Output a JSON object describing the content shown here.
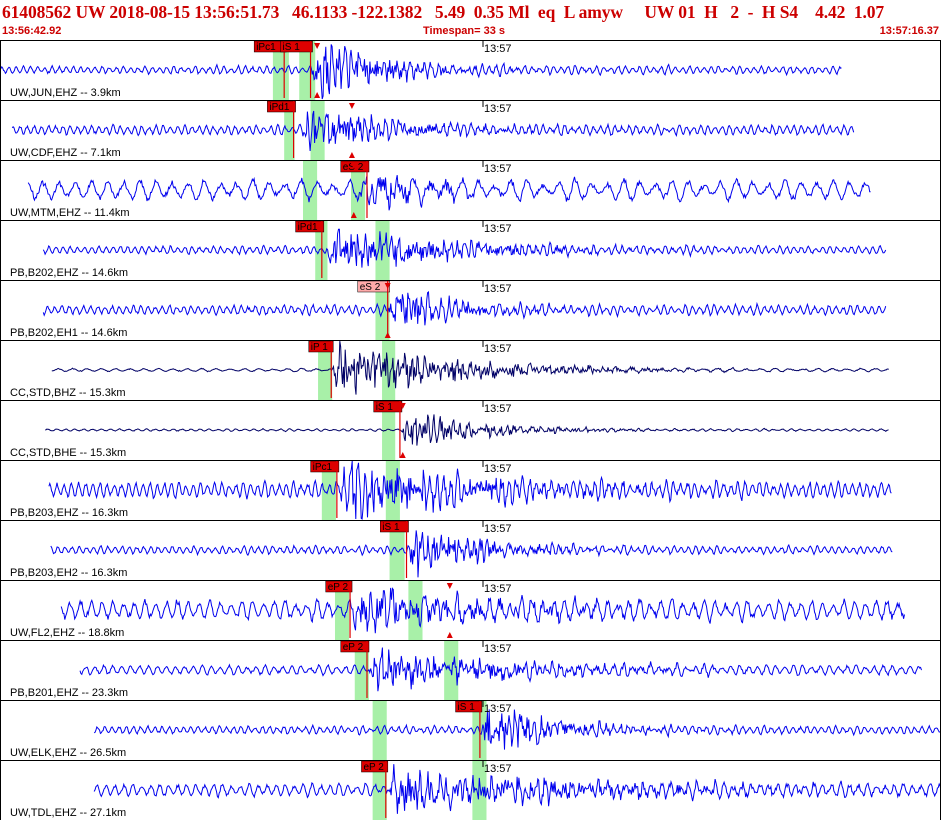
{
  "header": {
    "title": "61408562 UW 2018-08-15 13:56:51.73   46.1133 -122.1382   5.49  0.35 Ml  eq  L amyw     UW 01  H   2  -  H S4    4.42  1.07",
    "start_time": "13:56:42.92",
    "timespan": "Timespan=  33 s",
    "end_time": "13:57:16.37"
  },
  "colors": {
    "trace": "#0000ee",
    "trace_alt": "#000066",
    "pick_box": "#dd0000",
    "pick_box_light": "#ffaaaa",
    "window": "#a8f0a8",
    "frame": "#000000"
  },
  "chart_data": {
    "type": "line",
    "x_unit": "time (UTC)",
    "x_range": [
      "13:56:42.92",
      "13:57:16.37"
    ],
    "minute_mark": "13:57",
    "panels": [
      {
        "label": "UW,JUN,EHZ -- 3.9km",
        "start": 0.0,
        "end": 0.895,
        "onset": 0.33,
        "amp": 0.45,
        "noise": 0.05,
        "decay": 0.07,
        "period": 0.004,
        "color": "trace",
        "picks": [
          {
            "label": "iPc1",
            "t": 0.302,
            "box_w": 0.034,
            "light": false
          },
          {
            "label": "iS 1",
            "t": 0.33,
            "box_w": 0.034,
            "light": false
          }
        ],
        "windows": [
          {
            "start": 0.29,
            "end": 0.307
          },
          {
            "start": 0.318,
            "end": 0.335
          }
        ],
        "markers": [
          0.337
        ]
      },
      {
        "label": "UW,CDF,EHZ -- 7.1km",
        "start": 0.013,
        "end": 0.908,
        "onset": 0.317,
        "amp": 0.3,
        "noise": 0.06,
        "decay": 0.1,
        "period": 0.004,
        "color": "trace",
        "picks": [
          {
            "label": "iPd1",
            "t": 0.312,
            "box_w": 0.03,
            "light": false
          }
        ],
        "windows": [
          {
            "start": 0.302,
            "end": 0.313
          },
          {
            "start": 0.33,
            "end": 0.345
          }
        ],
        "markers": [
          0.374
        ]
      },
      {
        "label": "UW,MTM,EHZ -- 11.4km",
        "start": 0.03,
        "end": 0.926,
        "onset": 0.38,
        "amp": 0.28,
        "noise": 0.12,
        "decay": 0.06,
        "period": 0.009,
        "color": "trace",
        "picks": [
          {
            "label": "eS 2",
            "t": 0.39,
            "box_w": 0.03,
            "light": false
          }
        ],
        "windows": [
          {
            "start": 0.322,
            "end": 0.337
          },
          {
            "start": 0.373,
            "end": 0.388
          }
        ],
        "markers": [
          0.376
        ]
      },
      {
        "label": "PB,B202,EHZ -- 14.6km",
        "start": 0.046,
        "end": 0.942,
        "onset": 0.345,
        "amp": 0.35,
        "noise": 0.05,
        "decay": 0.12,
        "period": 0.004,
        "color": "trace",
        "picks": [
          {
            "label": "iPd1",
            "t": 0.342,
            "box_w": 0.03,
            "light": false
          }
        ],
        "windows": [
          {
            "start": 0.335,
            "end": 0.348
          },
          {
            "start": 0.399,
            "end": 0.414
          }
        ],
        "markers": []
      },
      {
        "label": "PB,B202,EH1 -- 14.6km",
        "start": 0.046,
        "end": 0.942,
        "onset": 0.412,
        "amp": 0.35,
        "noise": 0.06,
        "decay": 0.07,
        "period": 0.004,
        "color": "trace",
        "picks": [
          {
            "label": "eS 2",
            "t": 0.412,
            "box_w": 0.034,
            "light": true
          }
        ],
        "windows": [
          {
            "start": 0.399,
            "end": 0.414
          }
        ],
        "markers": [
          0.412
        ]
      },
      {
        "label": "CC,STD,BHZ -- 15.3km",
        "start": 0.055,
        "end": 0.945,
        "onset": 0.352,
        "amp": 0.4,
        "noise": 0.02,
        "decay": 0.12,
        "period": 0.008,
        "color": "trace_alt",
        "picks": [
          {
            "label": "iP 1",
            "t": 0.352,
            "box_w": 0.026,
            "light": false
          }
        ],
        "windows": [
          {
            "start": 0.338,
            "end": 0.353
          },
          {
            "start": 0.406,
            "end": 0.42
          }
        ],
        "markers": []
      },
      {
        "label": "CC,STD,BHE -- 15.3km",
        "start": 0.048,
        "end": 0.945,
        "onset": 0.425,
        "amp": 0.28,
        "noise": 0.015,
        "decay": 0.08,
        "period": 0.005,
        "color": "trace_alt",
        "picks": [
          {
            "label": "iS 1",
            "t": 0.425,
            "box_w": 0.03,
            "light": false
          }
        ],
        "windows": [
          {
            "start": 0.406,
            "end": 0.42
          }
        ],
        "markers": [
          0.428
        ]
      },
      {
        "label": "PB,B203,EHZ -- 16.3km",
        "start": 0.052,
        "end": 0.948,
        "onset": 0.358,
        "amp": 0.45,
        "noise": 0.1,
        "decay": 0.14,
        "period": 0.004,
        "color": "trace",
        "picks": [
          {
            "label": "iPc1",
            "t": 0.358,
            "box_w": 0.03,
            "light": false
          }
        ],
        "windows": [
          {
            "start": 0.342,
            "end": 0.357
          },
          {
            "start": 0.41,
            "end": 0.425
          }
        ],
        "markers": []
      },
      {
        "label": "PB,B203,EH2 -- 16.3km",
        "start": 0.054,
        "end": 0.949,
        "onset": 0.432,
        "amp": 0.35,
        "noise": 0.05,
        "decay": 0.08,
        "period": 0.004,
        "color": "trace",
        "picks": [
          {
            "label": "iS 1",
            "t": 0.432,
            "box_w": 0.03,
            "light": false
          }
        ],
        "windows": [
          {
            "start": 0.414,
            "end": 0.43
          }
        ],
        "markers": []
      },
      {
        "label": "UW,FL2,EHZ -- 18.8km",
        "start": 0.065,
        "end": 0.962,
        "onset": 0.372,
        "amp": 0.28,
        "noise": 0.12,
        "decay": 0.15,
        "period": 0.006,
        "color": "trace",
        "picks": [
          {
            "label": "eP 2",
            "t": 0.372,
            "box_w": 0.028,
            "light": false
          }
        ],
        "windows": [
          {
            "start": 0.356,
            "end": 0.371
          },
          {
            "start": 0.434,
            "end": 0.449
          }
        ],
        "markers": [
          0.478
        ]
      },
      {
        "label": "PB,B201,EHZ -- 23.3km",
        "start": 0.085,
        "end": 0.98,
        "onset": 0.39,
        "amp": 0.28,
        "noise": 0.06,
        "decay": 0.15,
        "period": 0.005,
        "color": "trace",
        "picks": [
          {
            "label": "eP 2",
            "t": 0.39,
            "box_w": 0.03,
            "light": false
          }
        ],
        "windows": [
          {
            "start": 0.377,
            "end": 0.392
          },
          {
            "start": 0.472,
            "end": 0.487
          }
        ],
        "markers": []
      },
      {
        "label": "UW,ELK,EHZ -- 26.5km",
        "start": 0.1,
        "end": 1.0,
        "onset": 0.51,
        "amp": 0.35,
        "noise": 0.05,
        "decay": 0.08,
        "period": 0.004,
        "color": "trace",
        "picks": [
          {
            "label": "iS 1",
            "t": 0.51,
            "box_w": 0.028,
            "light": false
          }
        ],
        "windows": [
          {
            "start": 0.396,
            "end": 0.411
          },
          {
            "start": 0.502,
            "end": 0.517
          }
        ],
        "markers": []
      },
      {
        "label": "UW,TDL,EHZ -- 27.1km",
        "start": 0.1,
        "end": 1.0,
        "onset": 0.41,
        "amp": 0.3,
        "noise": 0.08,
        "decay": 0.2,
        "period": 0.005,
        "color": "trace",
        "picks": [
          {
            "label": "eP 2",
            "t": 0.41,
            "box_w": 0.028,
            "light": false
          }
        ],
        "windows": [
          {
            "start": 0.396,
            "end": 0.411
          },
          {
            "start": 0.502,
            "end": 0.517
          }
        ],
        "markers": []
      }
    ]
  }
}
